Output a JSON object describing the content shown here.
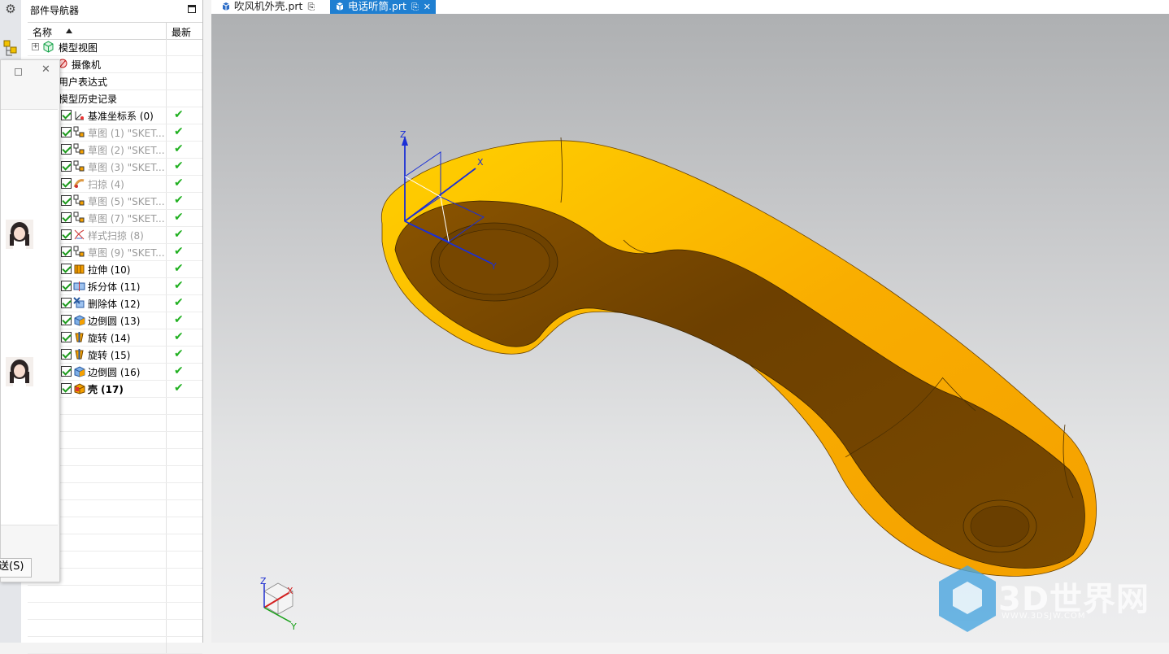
{
  "navigator": {
    "title": "部件导航器",
    "columns": {
      "name": "名称",
      "latest": "最新"
    },
    "rows": [
      {
        "label": "模型视图",
        "style": "normal"
      },
      {
        "label": "摄像机",
        "style": "normal"
      },
      {
        "label": "用户表达式",
        "style": "normal"
      },
      {
        "label": "模型历史记录",
        "style": "normal"
      },
      {
        "label": "基准坐标系 (0)",
        "style": "normal"
      },
      {
        "label": "草图 (1) \"SKET...",
        "style": "dim"
      },
      {
        "label": "草图 (2) \"SKET...",
        "style": "dim"
      },
      {
        "label": "草图 (3) \"SKET...",
        "style": "dim"
      },
      {
        "label": "扫掠 (4)",
        "style": "dim"
      },
      {
        "label": "草图 (5) \"SKET...",
        "style": "dim"
      },
      {
        "label": "草图 (7) \"SKET...",
        "style": "dim"
      },
      {
        "label": "样式扫掠 (8)",
        "style": "dim"
      },
      {
        "label": "草图 (9) \"SKET...",
        "style": "dim"
      },
      {
        "label": "拉伸 (10)",
        "style": "normal"
      },
      {
        "label": "拆分体 (11)",
        "style": "normal"
      },
      {
        "label": "删除体 (12)",
        "style": "normal"
      },
      {
        "label": "边倒圆 (13)",
        "style": "normal"
      },
      {
        "label": "旋转 (14)",
        "style": "normal"
      },
      {
        "label": "旋转 (15)",
        "style": "normal"
      },
      {
        "label": "边倒圆 (16)",
        "style": "normal"
      },
      {
        "label": "壳 (17)",
        "style": "bold"
      }
    ]
  },
  "tabs": [
    {
      "label": "吹风机外壳.prt",
      "active": false
    },
    {
      "label": "电话听筒.prt",
      "active": true
    }
  ],
  "floating_panel": {
    "button_label": "送(S)"
  },
  "viewport": {
    "model": "telephone handset shell",
    "model_color": "#f5a600",
    "wcs_labels": {
      "z": "Z",
      "x": "X",
      "y": "Y"
    },
    "triad_labels": {
      "z": "Z",
      "x": "X",
      "y": "Y"
    }
  },
  "watermark": {
    "text": "3D世界网",
    "url": "WWW.3DSJW.COM"
  },
  "colors": {
    "tab_active": "#1f7fd1",
    "check": "#20b020",
    "accent": "#1f7fd1"
  }
}
